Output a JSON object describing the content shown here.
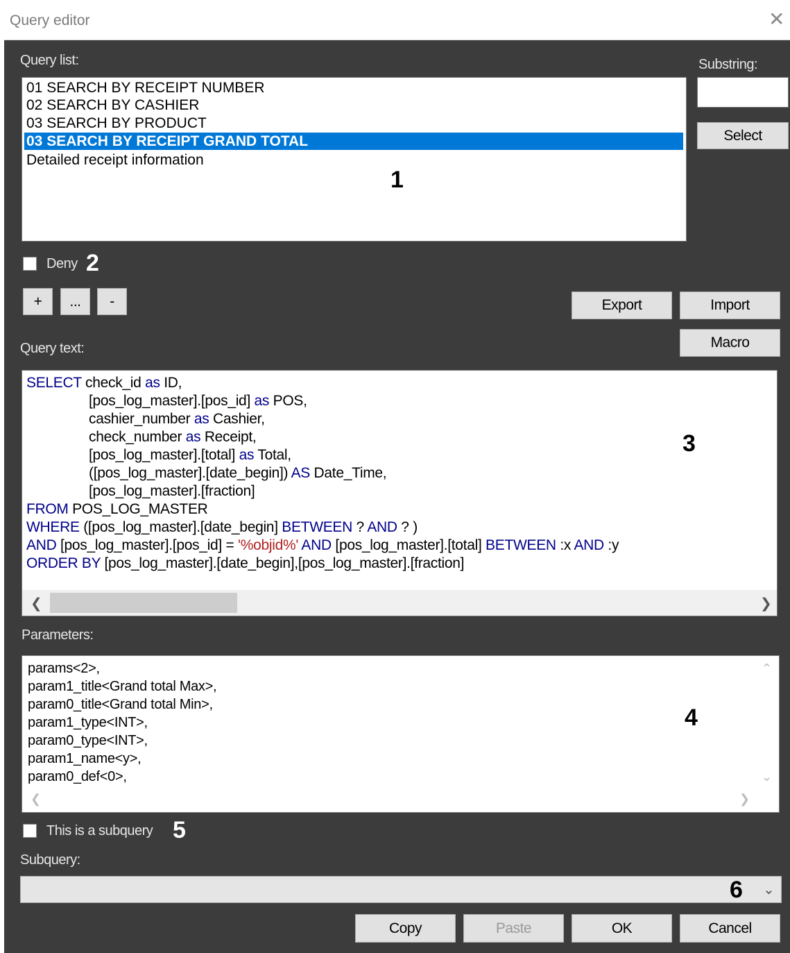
{
  "window": {
    "title": "Query editor"
  },
  "query_list": {
    "label": "Query list:",
    "items": [
      "01 SEARCH BY RECEIPT NUMBER",
      "02 SEARCH BY CASHIER",
      "03 SEARCH BY PRODUCT",
      "03 SEARCH BY RECEIPT GRAND TOTAL",
      "Detailed receipt information"
    ],
    "selected_index": 3,
    "callout": "1"
  },
  "substring": {
    "label": "Substring:",
    "value": "",
    "select_label": "Select"
  },
  "deny": {
    "label": "Deny",
    "checked": false,
    "callout": "2"
  },
  "toolbar": {
    "add": "+",
    "edit": "...",
    "remove": "-",
    "export": "Export",
    "import": "Import",
    "macro": "Macro"
  },
  "query_text": {
    "label": "Query text:",
    "callout": "3",
    "lines": {
      "l1a": "SELECT",
      "l1b": " check_id ",
      "l1c": "as",
      "l1d": " ID,",
      "l2a": "[pos_log_master].[pos_id] ",
      "l2b": "as",
      "l2c": " POS,",
      "l3a": "cashier_number ",
      "l3b": "as",
      "l3c": " Cashier,",
      "l4a": "check_number ",
      "l4b": "as",
      "l4c": " Receipt,",
      "l5a": "[pos_log_master].[total] ",
      "l5b": "as",
      "l5c": " Total,",
      "l6a": "([pos_log_master].[date_begin]) ",
      "l6b": "AS",
      "l6c": " Date_Time,",
      "l7a": "[pos_log_master].[fraction]",
      "l8a": "FROM",
      "l8b": " POS_LOG_MASTER",
      "l9a": "WHERE",
      "l9b": " ([pos_log_master].[date_begin] ",
      "l9c": "BETWEEN",
      "l9d": " ? ",
      "l9e": "AND",
      "l9f": " ? )",
      "l10a": "AND",
      "l10b": " [pos_log_master].[pos_id] = ",
      "l10c": "'%objid%'",
      "l10d": " AND",
      "l10e": " [pos_log_master].[total] ",
      "l10f": "BETWEEN",
      "l10g": " :x ",
      "l10h": "AND",
      "l10i": " :y",
      "l11a": "ORDER BY",
      "l11b": " [pos_log_master].[date_begin],[pos_log_master].[fraction]"
    }
  },
  "parameters": {
    "label": "Parameters:",
    "callout": "4",
    "lines": [
      "params<2>,",
      "param1_title<Grand total Max>,",
      "param0_title<Grand total Min>,",
      "param1_type<INT>,",
      "param0_type<INT>,",
      "param1_name<y>,",
      "param0_def<0>,"
    ]
  },
  "subquery_flag": {
    "label": "This is a subquery",
    "checked": false,
    "callout": "5"
  },
  "subquery": {
    "label": "Subquery:",
    "value": "",
    "callout": "6"
  },
  "footer": {
    "copy": "Copy",
    "paste": "Paste",
    "ok": "OK",
    "cancel": "Cancel"
  },
  "icons": {
    "close": "close-icon",
    "left": "chevron-left-icon",
    "right": "chevron-right-icon",
    "up": "chevron-up-icon",
    "down": "chevron-down-icon"
  },
  "colors": {
    "selection": "#0078d7",
    "keyword": "#00008b",
    "string": "#b22222",
    "background": "#3c3c3c"
  }
}
